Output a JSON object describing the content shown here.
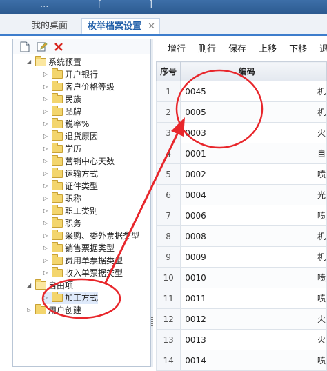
{
  "window": {
    "title_fragment_left": "...",
    "title_fragment_mid": "[",
    "title_fragment_right": "]"
  },
  "tabs": [
    {
      "label": "我的桌面"
    },
    {
      "label": "枚举档案设置",
      "close": "✕"
    }
  ],
  "left_toolbar": {
    "icons": [
      "new-icon",
      "edit-icon",
      "delete-icon"
    ]
  },
  "tree": {
    "root1": "系统预置",
    "items": [
      "开户银行",
      "客户价格等级",
      "民族",
      "品牌",
      "税率%",
      "退货原因",
      "学历",
      "营销中心天数",
      "运输方式",
      "证件类型",
      "职称",
      "职工类别",
      "职务",
      "采购、委外票据类型",
      "销售票据类型",
      "费用单票据类型",
      "收入单票据类型"
    ],
    "root2": "自由项",
    "child2": "加工方式",
    "root3": "用户创建"
  },
  "right_toolbar": [
    "增行",
    "删行",
    "保存",
    "上移",
    "下移",
    "退出"
  ],
  "table": {
    "headers": [
      "序号",
      "编码",
      ""
    ],
    "rows": [
      {
        "seq": "1",
        "code": "0045",
        "name": "机"
      },
      {
        "seq": "2",
        "code": "0005",
        "name": "机"
      },
      {
        "seq": "3",
        "code": "0003",
        "name": "火"
      },
      {
        "seq": "4",
        "code": "0001",
        "name": "自"
      },
      {
        "seq": "5",
        "code": "0002",
        "name": "喷"
      },
      {
        "seq": "6",
        "code": "0004",
        "name": "光"
      },
      {
        "seq": "7",
        "code": "0006",
        "name": "喷"
      },
      {
        "seq": "8",
        "code": "0008",
        "name": "机"
      },
      {
        "seq": "9",
        "code": "0009",
        "name": "机"
      },
      {
        "seq": "10",
        "code": "0010",
        "name": "喷"
      },
      {
        "seq": "11",
        "code": "0011",
        "name": "喷"
      },
      {
        "seq": "12",
        "code": "0012",
        "name": "火"
      },
      {
        "seq": "13",
        "code": "0013",
        "name": "火"
      },
      {
        "seq": "14",
        "code": "0014",
        "name": "喷"
      }
    ]
  },
  "colors": {
    "accent": "#3d7dcc",
    "annotation": "#e8262b",
    "folder": "#f3d56d"
  }
}
